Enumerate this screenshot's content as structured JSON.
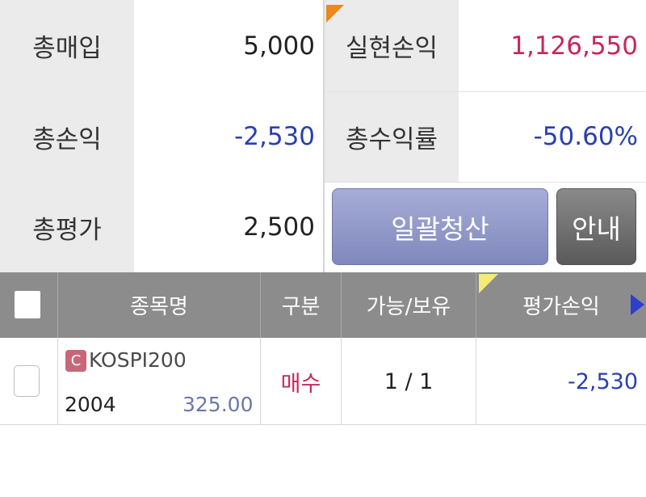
{
  "summary": {
    "total_purchase_label": "총매입",
    "total_purchase_value": "5,000",
    "realized_pl_label": "실현손익",
    "realized_pl_value": "1,126,550",
    "total_pl_label": "총손익",
    "total_pl_value": "-2,530",
    "total_return_label": "총수익률",
    "total_return_value": "-50.60%",
    "total_valuation_label": "총평가",
    "total_valuation_value": "2,500"
  },
  "buttons": {
    "liquidate_all": "일괄청산",
    "guide": "안내"
  },
  "table": {
    "headers": {
      "name": "종목명",
      "type": "구분",
      "available_held": "가능/보유",
      "valuation_pl": "평가손익"
    },
    "rows": [
      {
        "badge": "C",
        "name": "KOSPI200",
        "code": "2004",
        "price": "325.00",
        "type": "매수",
        "available_held": "1 / 1",
        "valuation_pl": "-2,530"
      }
    ]
  },
  "colors": {
    "positive": "#c8265e",
    "negative": "#2a3fb0",
    "label_bg": "#ebebeb",
    "header_bg": "#8c8c8c",
    "liquidate_button": "#8d95c6",
    "guide_button": "#6e6e6e"
  }
}
